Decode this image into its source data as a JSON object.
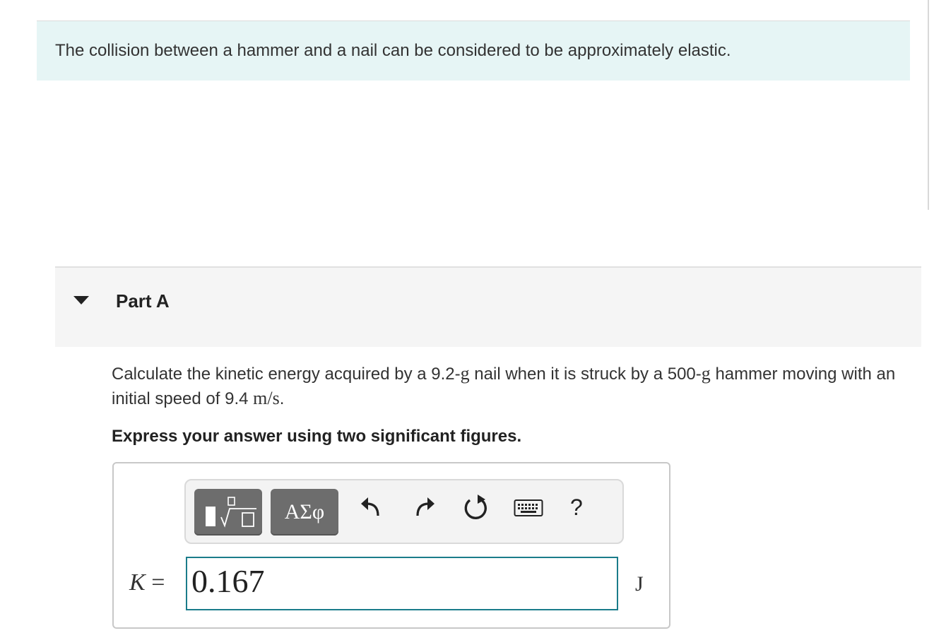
{
  "intro": {
    "text": "The collision between a hammer and a nail can be considered to be approximately elastic."
  },
  "part": {
    "title": "Part A"
  },
  "question": {
    "text_before": "Calculate the kinetic energy acquired by a 9.2-",
    "unit_g1": "g",
    "text_mid": " nail when it is struck by a 500-",
    "unit_g2": "g",
    "text_after": " hammer moving with an initial speed of 9.4 ",
    "speed_unit": "m/s",
    "end": "."
  },
  "instructions": "Express your answer using two significant figures.",
  "toolbar": {
    "symbols_label": "ΑΣφ",
    "help_label": "?",
    "icons": [
      "templates-icon",
      "undo-icon",
      "redo-icon",
      "reset-icon",
      "keyboard-icon"
    ]
  },
  "answer": {
    "variable": "K",
    "equals": "=",
    "value": "0.167",
    "unit": "J"
  },
  "colors": {
    "banner_bg": "#e6f5f5",
    "input_border": "#1a7c8a",
    "toolbar_button": "#6d6d6d"
  }
}
